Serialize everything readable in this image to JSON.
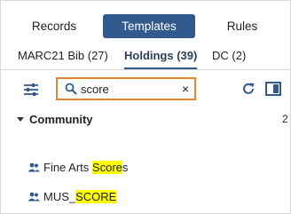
{
  "top_tabs": [
    {
      "label": "Records",
      "active": false
    },
    {
      "label": "Templates",
      "active": true
    },
    {
      "label": "Rules",
      "active": false
    }
  ],
  "sub_tabs": [
    {
      "label": "MARC21 Bib (27)",
      "active": false
    },
    {
      "label": "Holdings (39)",
      "active": true
    },
    {
      "label": "DC (2)",
      "active": false
    }
  ],
  "toolbar": {
    "search_value": "score",
    "clear_label": "×",
    "filter_icon": "sliders-icon",
    "search_icon": "search-icon",
    "refresh_icon": "refresh-icon",
    "panel_icon": "panel-toggle-icon"
  },
  "tree": {
    "group": {
      "label": "Community",
      "count": "2",
      "expanded": true
    },
    "items": [
      {
        "text_before": "Fine Arts ",
        "highlight": "Score",
        "text_after": "s",
        "icon": "users-icon"
      },
      {
        "text_before": "MUS_",
        "highlight": "SCORE",
        "text_after": "",
        "icon": "users-icon"
      }
    ]
  },
  "colors": {
    "accent": "#325a8d",
    "search_border": "#e8832a",
    "highlight": "#ffff00"
  }
}
